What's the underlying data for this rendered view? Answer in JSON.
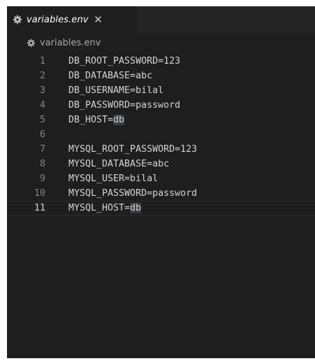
{
  "tab": {
    "icon": "gear-icon",
    "label": "variables.env",
    "close_label": "✕"
  },
  "breadcrumb": {
    "icon": "gear-icon",
    "label": "variables.env"
  },
  "editor": {
    "active_line": 11,
    "highlighted_word": "db",
    "lines": [
      {
        "number": "1",
        "text": "DB_ROOT_PASSWORD=123"
      },
      {
        "number": "2",
        "text": "DB_DATABASE=abc"
      },
      {
        "number": "3",
        "text": "DB_USERNAME=bilal"
      },
      {
        "number": "4",
        "text": "DB_PASSWORD=password"
      },
      {
        "number": "5",
        "text": "DB_HOST=",
        "highlight": "db"
      },
      {
        "number": "6",
        "text": ""
      },
      {
        "number": "7",
        "text": "MYSQL_ROOT_PASSWORD=123"
      },
      {
        "number": "8",
        "text": "MYSQL_DATABASE=abc"
      },
      {
        "number": "9",
        "text": "MYSQL_USER=bilal"
      },
      {
        "number": "10",
        "text": "MYSQL_PASSWORD=password"
      },
      {
        "number": "11",
        "text": "MYSQL_HOST=",
        "highlight": "db"
      }
    ]
  },
  "colors": {
    "editor_background": "#1e1e1e",
    "tab_bar_background": "#252526",
    "text": "#d4d4d4",
    "line_number": "#858585",
    "selection_highlight": "#3a3d41"
  }
}
